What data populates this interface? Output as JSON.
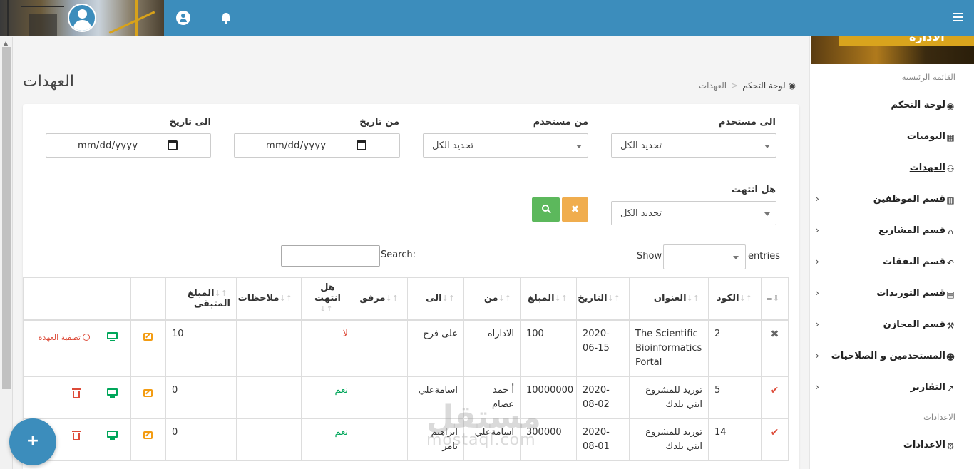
{
  "page": {
    "title": "العهدات"
  },
  "breadcrumb": {
    "home": "لوحة التحكم",
    "current": "العهدات"
  },
  "filters": {
    "to_user": {
      "label": "الى مستخدم",
      "value": "تحديد الكل"
    },
    "from_user": {
      "label": "من مستخدم",
      "value": "تحديد الكل"
    },
    "from_date": {
      "label": "من تاريخ",
      "placeholder": "mm/dd/yyyy"
    },
    "to_date": {
      "label": "الى تاريخ",
      "placeholder": "mm/dd/yyyy"
    },
    "finished": {
      "label": "هل انتهت",
      "value": "تحديد الكل"
    },
    "reset_glyph": "✖"
  },
  "datatable": {
    "show": "Show",
    "entries": "entries",
    "search": "Search:"
  },
  "table": {
    "columns": [
      "الكود",
      "العنوان",
      "التاريخ",
      "المبلغ",
      "من",
      "الى",
      "مرفق",
      "هل انتهت",
      "ملاحظات",
      "المبلغ المتبقى"
    ],
    "rows": [
      {
        "status": "✖",
        "code": "2",
        "title": "The Scientific Bioinformatics Portal",
        "date": "2020-06-15",
        "amount": "100",
        "from": "الاداراه",
        "to": "على فرج",
        "attachment": "",
        "finished": "لا",
        "notes": "",
        "remaining": "10",
        "settle": "تصفية العهده"
      },
      {
        "status": "✔",
        "code": "5",
        "title": "توريد للمشروع ابني بلدك",
        "date": "2020-08-02",
        "amount": "10000000",
        "from": "أ حمد عصام",
        "to": "اسامةعلي",
        "attachment": "",
        "finished": "نعم",
        "notes": "",
        "remaining": "0"
      },
      {
        "status": "✔",
        "code": "14",
        "title": "توريد للمشروع ابني بلدك",
        "date": "2020-08-01",
        "amount": "300000",
        "from": "اسامةعلي",
        "to": "ابراهيم تامر",
        "attachment": "",
        "finished": "نعم",
        "notes": "",
        "remaining": "0"
      }
    ]
  },
  "fab_label": "+",
  "watermark": {
    "ar": "مستقل",
    "en": "mostaql.com"
  },
  "sidebar": {
    "logo_text": "الادارة",
    "main_header": "القائمة الرئيسيه",
    "items": [
      {
        "label": "لوحة التحكم",
        "icon": "dashboard-icon",
        "glyph": "◉"
      },
      {
        "label": "اليوميات",
        "icon": "calendar-icon",
        "glyph": "▦"
      },
      {
        "label": "العهدات",
        "icon": "handshake-icon",
        "glyph": "⚇"
      },
      {
        "label": "قسم الموظفين",
        "icon": "bar-chart-icon",
        "glyph": "▥"
      },
      {
        "label": "قسم المشاريع",
        "icon": "institution-icon",
        "glyph": "⌂"
      },
      {
        "label": "قسم النفقات",
        "icon": "reply-icon",
        "glyph": "↶"
      },
      {
        "label": "قسم التوريدات",
        "icon": "card-icon",
        "glyph": "▤"
      },
      {
        "label": "قسم المخازن",
        "icon": "wrench-icon",
        "glyph": "⚒"
      },
      {
        "label": "المستخدمين و الصلاحيات",
        "icon": "users-icon",
        "glyph": "☻"
      },
      {
        "label": "التقارير",
        "icon": "line-chart-icon",
        "glyph": "↗"
      }
    ],
    "settings_header": "الاعدادات",
    "settings_item": {
      "label": "الاعدادات",
      "icon": "cogs-icon",
      "glyph": "⚙"
    }
  },
  "colors": {
    "primary": "#3c8dbc",
    "success": "#5cb85c",
    "warning": "#f0ad4e",
    "danger": "#dd4b39"
  }
}
